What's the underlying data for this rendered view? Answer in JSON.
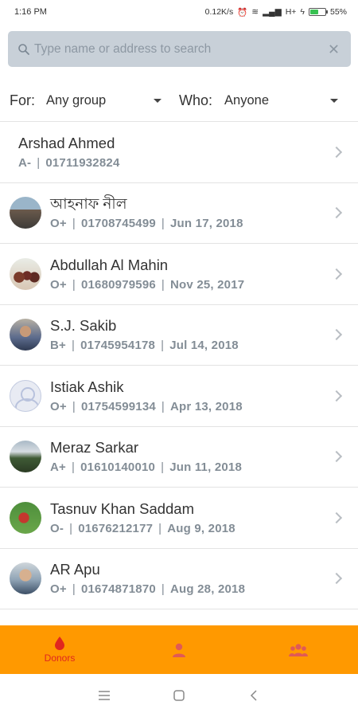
{
  "status_bar": {
    "time": "1:16 PM",
    "net_speed": "0.12K/s",
    "network": "H+",
    "battery": "55%",
    "battery_level": 0.55
  },
  "search": {
    "placeholder": "Type name or address to search",
    "value": ""
  },
  "filters": {
    "for_label": "For:",
    "for_value": "Any group",
    "who_label": "Who:",
    "who_value": "Anyone"
  },
  "donors": [
    {
      "name": "Arshad Ahmed",
      "blood_group": "A-",
      "phone": "01711932824",
      "date": "",
      "avatar": "none"
    },
    {
      "name": "আহনাফ নীল",
      "blood_group": "O+",
      "phone": "01708745499",
      "date": "Jun 17, 2018",
      "avatar": "photo"
    },
    {
      "name": "Abdullah Al Mahin",
      "blood_group": "O+",
      "phone": "01680979596",
      "date": "Nov 25, 2017",
      "avatar": "photo"
    },
    {
      "name": "S.J. Sakib",
      "blood_group": "B+",
      "phone": "01745954178",
      "date": "Jul 14, 2018",
      "avatar": "photo"
    },
    {
      "name": "Istiak Ashik",
      "blood_group": "O+",
      "phone": "01754599134",
      "date": "Apr 13, 2018",
      "avatar": "placeholder"
    },
    {
      "name": "Meraz Sarkar",
      "blood_group": "A+",
      "phone": "01610140010",
      "date": "Jun 11, 2018",
      "avatar": "photo"
    },
    {
      "name": "Tasnuv Khan Saddam",
      "blood_group": "O-",
      "phone": "01676212177",
      "date": "Aug 9, 2018",
      "avatar": "photo"
    },
    {
      "name": "AR Apu",
      "blood_group": "O+",
      "phone": "01674871870",
      "date": "Aug 28, 2018",
      "avatar": "photo"
    }
  ],
  "bottom_nav": {
    "donors_label": "Donors",
    "active_color": "#e0271f",
    "inactive_color": "#e05a56",
    "background": "#ff9900"
  },
  "colors": {
    "search_bg": "#c8d0d8",
    "subtext": "#838d96"
  }
}
